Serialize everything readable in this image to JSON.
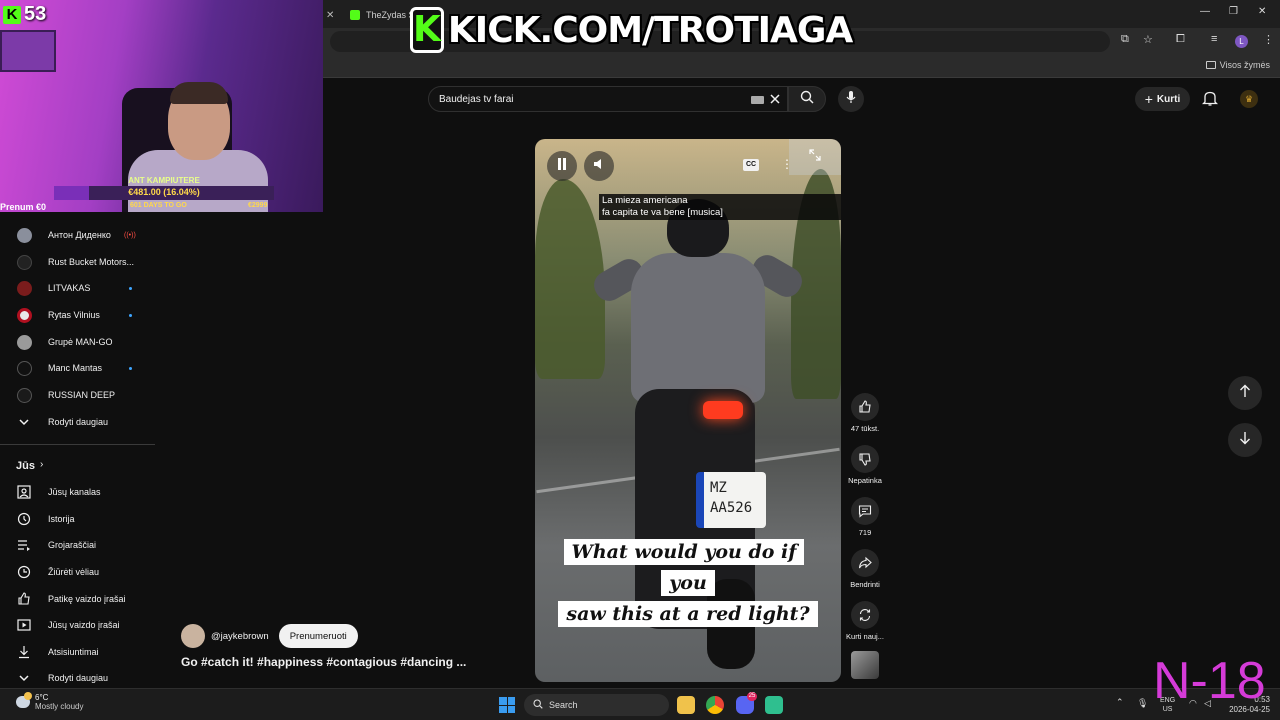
{
  "browser": {
    "tabs": [
      {
        "title": "TheZydas St"
      }
    ],
    "bookmarks_folder": "Visos žymės",
    "profile_initial": "L"
  },
  "overlay": {
    "kick_logo_letter": "K",
    "kick_url": "KICK.COM/TROTIAGA",
    "viewer_count": "53",
    "goal_title": "ANT KAMPIUTERE",
    "goal_amount": "€481.00 (16.04%)",
    "goal_days": "601 DAYS TO GO",
    "goal_target": "€2999",
    "goal_progress": 0.1604,
    "clipped_label": "Prenum €0",
    "rating_badge": "N-18"
  },
  "sidebar": {
    "subscriptions": [
      {
        "label": "Антон Диденко",
        "status": "live"
      },
      {
        "label": "Rust Bucket Motors...",
        "status": "none"
      },
      {
        "label": "LITVAKAS",
        "status": "new"
      },
      {
        "label": "Rytas Vilnius",
        "status": "new"
      },
      {
        "label": "Grupė MAN-GO",
        "status": "none"
      },
      {
        "label": "Manc Mantas",
        "status": "new"
      },
      {
        "label": "RUSSIAN DEEP",
        "status": "none"
      }
    ],
    "show_more": "Rodyti daugiau",
    "you_section": "Jūs",
    "you_items": [
      {
        "label": "Jūsų kanalas",
        "icon": "channel-icon"
      },
      {
        "label": "Istorija",
        "icon": "history-icon"
      },
      {
        "label": "Grojaraščiai",
        "icon": "playlists-icon"
      },
      {
        "label": "Žiūrėti vėliau",
        "icon": "watch-later-icon"
      },
      {
        "label": "Patikę vaizdo įrašai",
        "icon": "liked-icon"
      },
      {
        "label": "Jūsų vaizdo įrašai",
        "icon": "your-videos-icon"
      },
      {
        "label": "Atsisiuntimai",
        "icon": "downloads-icon"
      },
      {
        "label": "Rodyti daugiau",
        "icon": "chevron-down-icon"
      }
    ]
  },
  "header": {
    "search_value": "Baudejas tv farai",
    "create_label": "Kurti"
  },
  "short": {
    "captions": [
      "La mieza americana",
      "fa capita te va bene [musica]"
    ],
    "overlay_text": [
      "What would you do if you",
      "saw this at a red light?"
    ],
    "plate_lines": [
      "MZ",
      "AA526"
    ],
    "cc_label": "CC",
    "likes": "47 tūkst.",
    "dislike_label": "Nepatinka",
    "comments": "719",
    "share_label": "Bendrinti",
    "remix_label": "Kurti nauj...",
    "channel": "@jaykebrown",
    "subscribe_label": "Prenumeruoti",
    "title": "Go #catch it! #happiness #contagious #dancing ..."
  },
  "taskbar": {
    "temperature": "6°C",
    "weather": "Mostly cloudy",
    "search_label": "Search",
    "lang": [
      "ENG",
      "US"
    ],
    "time": "0:53",
    "date": "2026-04-25",
    "discord_badge": "25"
  },
  "colors": {
    "kick_green": "#53fc18",
    "youtube_bg": "#0f0f0f",
    "badge_magenta": "#d53bd8"
  }
}
